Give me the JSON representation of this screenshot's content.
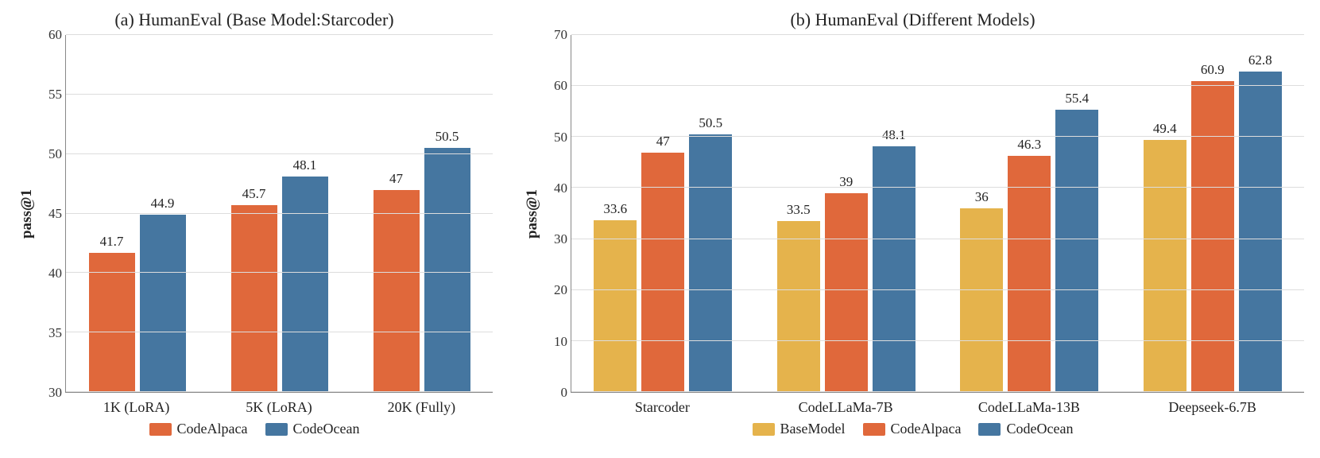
{
  "chart_data": [
    {
      "id": "a",
      "type": "bar",
      "title": "(a) HumanEval (Base Model:Starcoder)",
      "ylabel": "pass@1",
      "xlabel": "",
      "ylim": [
        30,
        60
      ],
      "ytick_step": 5,
      "categories": [
        "1K (LoRA)",
        "5K (LoRA)",
        "20K (Fully)"
      ],
      "series": [
        {
          "name": "CodeAlpaca",
          "color": "#e0683b",
          "values": [
            41.7,
            45.7,
            47
          ]
        },
        {
          "name": "CodeOcean",
          "color": "#4576a0",
          "values": [
            44.9,
            48.1,
            50.5
          ]
        }
      ]
    },
    {
      "id": "b",
      "type": "bar",
      "title": "(b) HumanEval (Different Models)",
      "ylabel": "pass@1",
      "xlabel": "",
      "ylim": [
        0,
        70
      ],
      "ytick_step": 10,
      "categories": [
        "Starcoder",
        "CodeLLaMa-7B",
        "CodeLLaMa-13B",
        "Deepseek-6.7B"
      ],
      "series": [
        {
          "name": "BaseModel",
          "color": "#e5b34c",
          "values": [
            33.6,
            33.5,
            36,
            49.4
          ]
        },
        {
          "name": "CodeAlpaca",
          "color": "#e0683b",
          "values": [
            47,
            39,
            46.3,
            60.9
          ]
        },
        {
          "name": "CodeOcean",
          "color": "#4576a0",
          "values": [
            50.5,
            48.1,
            55.4,
            62.8
          ]
        }
      ]
    }
  ],
  "legend": {
    "a": [
      "CodeAlpaca",
      "CodeOcean"
    ],
    "b": [
      "BaseModel",
      "CodeAlpaca",
      "CodeOcean"
    ]
  },
  "colors": {
    "BaseModel": "#e5b34c",
    "CodeAlpaca": "#e0683b",
    "CodeOcean": "#4576a0"
  }
}
